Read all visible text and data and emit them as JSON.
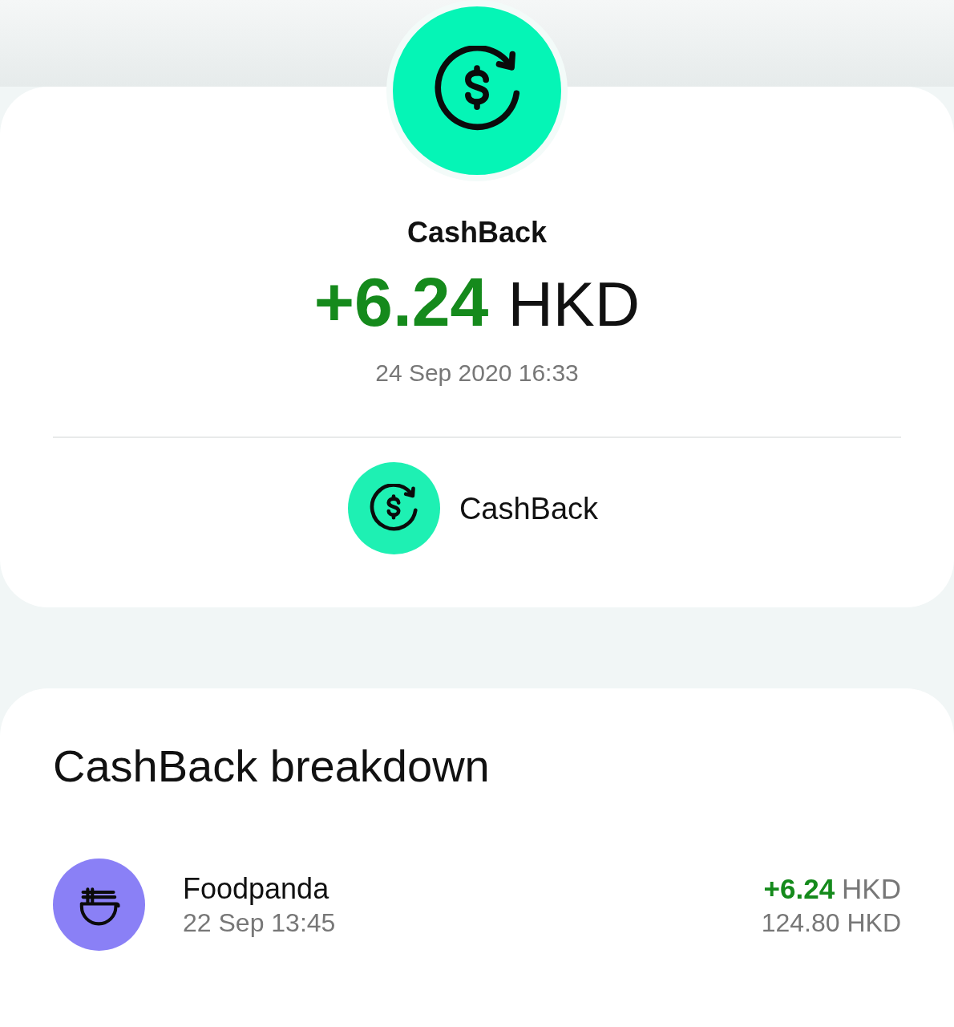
{
  "transaction": {
    "kind": "cashback",
    "title": "CashBack",
    "amount": "+6.24",
    "currency": "HKD",
    "datetime": "24 Sep 2020 16:33",
    "category": {
      "kind": "cashback",
      "label": "CashBack"
    }
  },
  "breakdown": {
    "title": "CashBack breakdown",
    "items": [
      {
        "kind": "food",
        "merchant": "Foodpanda",
        "datetime": "22 Sep 13:45",
        "cashback": "+6.24",
        "currency": "HKD",
        "spent": "124.80 HKD"
      }
    ]
  }
}
